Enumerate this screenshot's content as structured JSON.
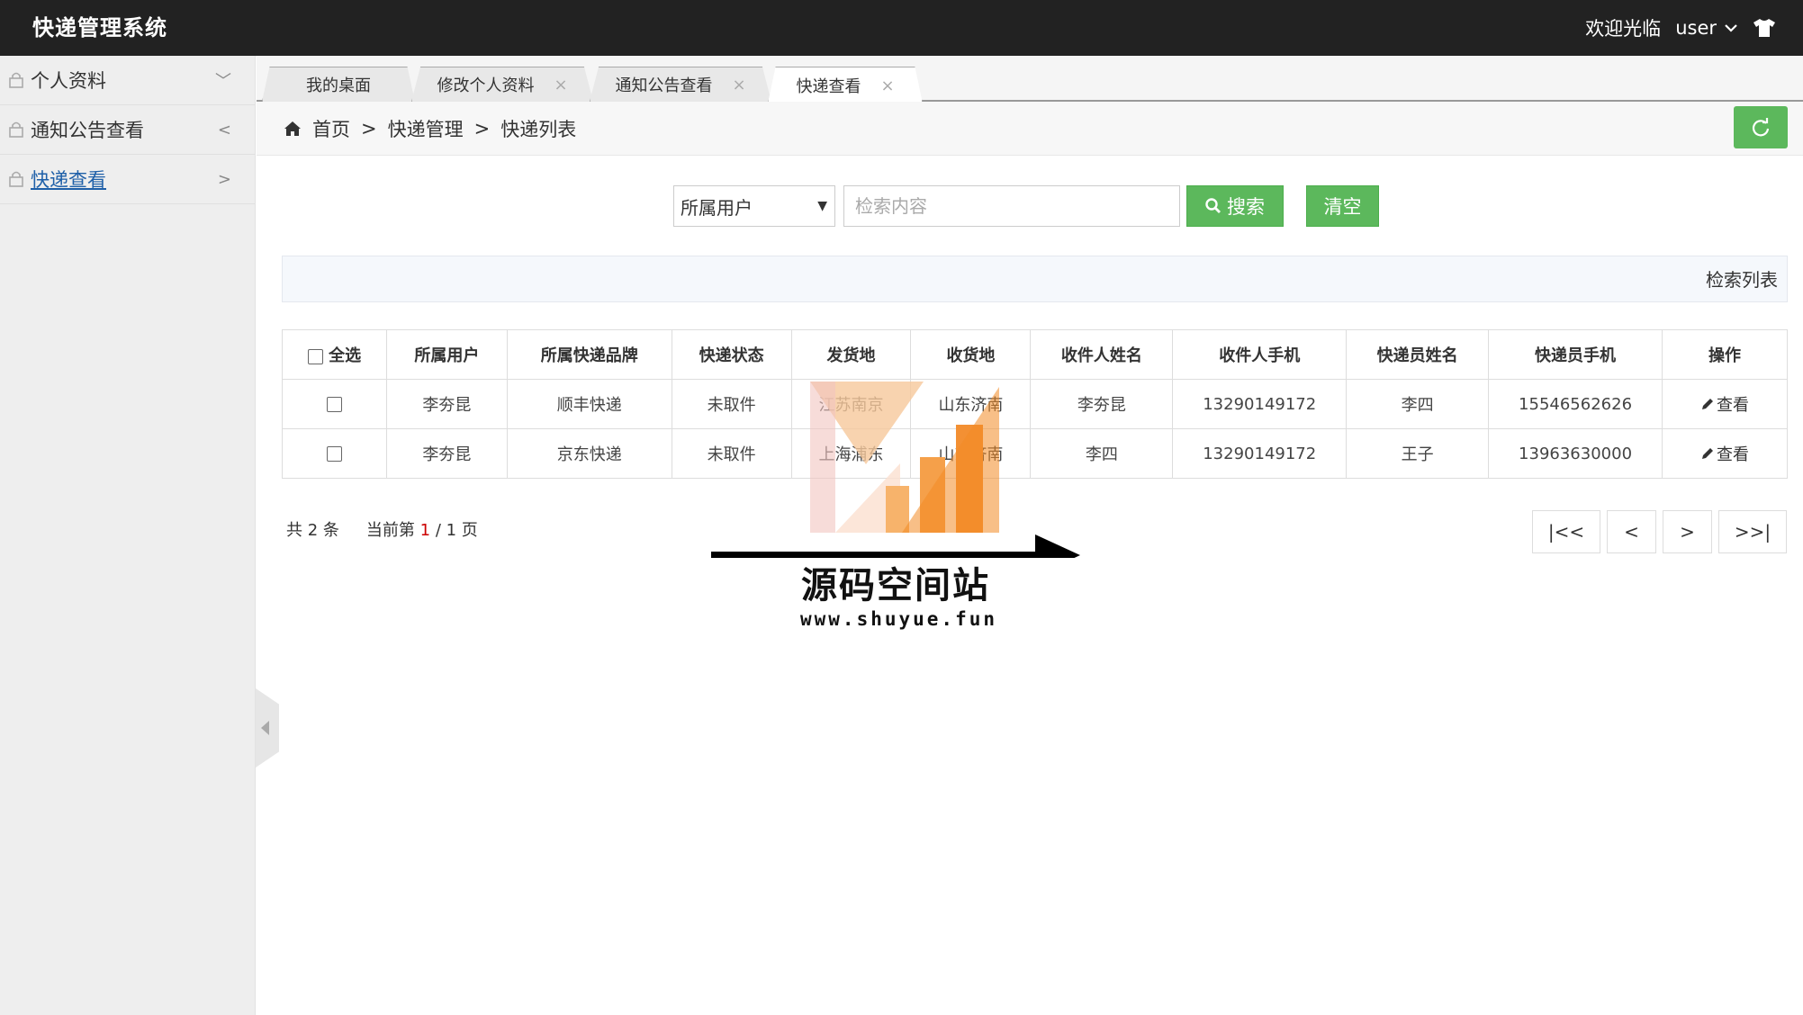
{
  "app": {
    "title": "快递管理系统",
    "welcome": "欢迎光临",
    "username": "user"
  },
  "sidebar": {
    "items": [
      {
        "label": "个人资料",
        "arrow": "﹀"
      },
      {
        "label": "通知公告查看",
        "arrow": "<"
      },
      {
        "label": "快递查看",
        "arrow": ">"
      }
    ]
  },
  "tabs": [
    {
      "label": "我的桌面"
    },
    {
      "label": "修改个人资料",
      "close": "×"
    },
    {
      "label": "通知公告查看",
      "close": "×"
    },
    {
      "label": "快递查看",
      "close": "×"
    }
  ],
  "breadcrumb": {
    "home": "首页",
    "sep1": ">",
    "level1": "快递管理",
    "sep2": ">",
    "level2": "快递列表"
  },
  "search": {
    "field_selected": "所属用户",
    "placeholder": "检索内容",
    "search_label": "搜索",
    "clear_label": "清空"
  },
  "panel": {
    "title": "检索列表"
  },
  "table": {
    "select_all": "全选",
    "columns": [
      "所属用户",
      "所属快递品牌",
      "快递状态",
      "发货地",
      "收货地",
      "收件人姓名",
      "收件人手机",
      "快递员姓名",
      "快递员手机",
      "操作"
    ],
    "rows": [
      [
        "李夯昆",
        "顺丰快递",
        "未取件",
        "江苏南京",
        "山东济南",
        "李夯昆",
        "13290149172",
        "李四",
        "15546562626",
        "查看"
      ],
      [
        "李夯昆",
        "京东快递",
        "未取件",
        "上海浦东",
        "山东济南",
        "李四",
        "13290149172",
        "王子",
        "13963630000",
        "查看"
      ]
    ]
  },
  "pagination": {
    "total": "共 2 条",
    "current_prefix": "当前第",
    "current_page": "1",
    "current_suffix": "/ 1 页",
    "first": "|<<",
    "prev": "<",
    "next": ">",
    "last": ">>|"
  },
  "watermark": {
    "name": "源码空间站",
    "url": "www.shuyue.fun"
  },
  "colors": {
    "topbar": "#222222",
    "accent_green": "#5cb85c",
    "link_blue": "#1e5fa8",
    "page_red": "#cc0000"
  }
}
